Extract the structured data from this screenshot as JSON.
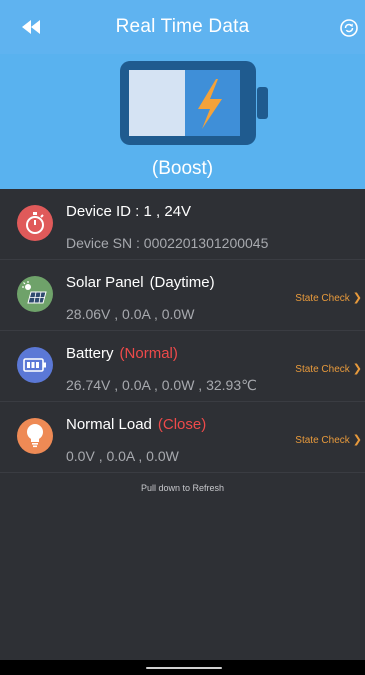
{
  "header": {
    "title": "Real Time Data",
    "back_icon": "double-chevron-left-icon",
    "refresh_icon": "refresh-circle-icon"
  },
  "hero": {
    "mode": "(Boost)",
    "battery_icon": "charging-battery-icon",
    "charge_fraction": 0.5
  },
  "rows": [
    {
      "icon": "stopwatch-icon",
      "title": "Device ID : 1 , 24V",
      "values": "Device SN : 0002201301200045",
      "color": "#e05a5a"
    },
    {
      "icon": "solar-panel-icon",
      "title": "Solar Panel",
      "subtitle": "(Daytime)",
      "values": "28.06V , 0.0A , 0.0W",
      "action": "State Check",
      "color": "#6fa26a"
    },
    {
      "icon": "battery-icon",
      "title": "Battery",
      "status": "(Normal)",
      "values": "26.74V , 0.0A , 0.0W , 32.93℃",
      "action": "State Check",
      "color": "#5b78d6"
    },
    {
      "icon": "light-bulb-icon",
      "title": "Normal Load",
      "status": "(Close)",
      "values": "0.0V , 0.0A , 0.0W",
      "action": "State Check",
      "color": "#ee8a55"
    }
  ],
  "footer": {
    "hint": "Pull down to Refresh"
  },
  "colors": {
    "header_bg": "#5fb3f0",
    "body_bg": "#2e3035",
    "accent_orange": "#e89a3c",
    "status_red": "#ee4a4a"
  }
}
